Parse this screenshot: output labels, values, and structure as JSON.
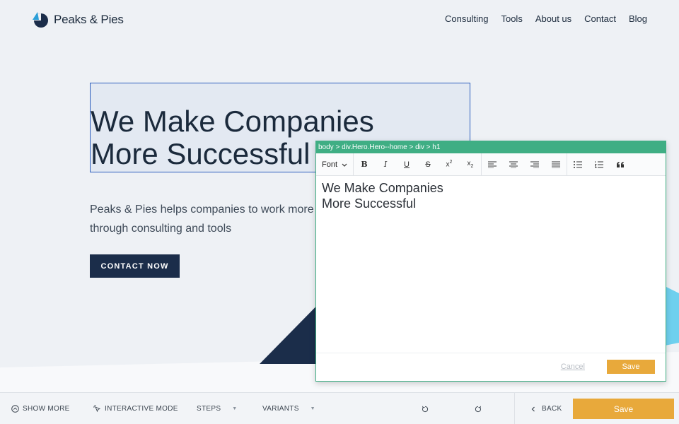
{
  "site": {
    "logo_text": "Peaks & Pies",
    "nav": [
      "Consulting",
      "Tools",
      "About us",
      "Contact",
      "Blog"
    ]
  },
  "hero": {
    "title_line1": "We Make Companies",
    "title_line2": "More Successful",
    "subtitle_line1": "Peaks & Pies helps companies to work more effectively",
    "subtitle_line2": "through consulting and tools",
    "cta_label": "CONTACT NOW"
  },
  "editor": {
    "path": "body > div.Hero.Hero--home > div > h1",
    "font_label": "Font",
    "content_line1": "We Make Companies",
    "content_line2": "More Successful",
    "cancel_label": "Cancel",
    "save_label": "Save"
  },
  "appbar": {
    "show_more": "SHOW MORE",
    "interactive_mode": "INTERACTIVE MODE",
    "steps": "STEPS",
    "variants": "VARIANTS",
    "back": "BACK",
    "save": "Save"
  },
  "colors": {
    "navy": "#1b2d4a",
    "editor_green": "#3fae84",
    "accent_orange": "#e8a93b",
    "selection_blue": "#2b5dbd",
    "light_blue": "#5ec8ec"
  }
}
